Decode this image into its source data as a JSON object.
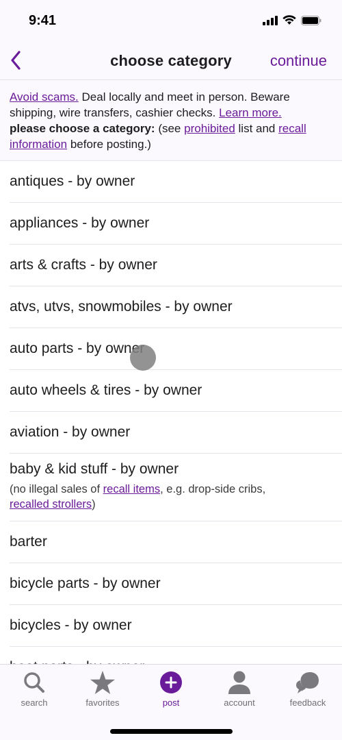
{
  "status_bar": {
    "time": "9:41"
  },
  "nav": {
    "title": "choose category",
    "continue_label": "continue"
  },
  "notice": {
    "avoid_scams": "Avoid scams.",
    "text1": " Deal locally and meet in person. Beware shipping, wire transfers, cashier checks. ",
    "learn_more": "Learn more.",
    "bold": "please choose a category:",
    "text2": " (see ",
    "prohibited": "prohibited",
    "text3": " list and ",
    "recall_info": "recall information",
    "text4": " before posting.)"
  },
  "categories": [
    {
      "label": "antiques - by owner"
    },
    {
      "label": "appliances - by owner"
    },
    {
      "label": "arts & crafts - by owner"
    },
    {
      "label": "atvs, utvs, snowmobiles - by owner"
    },
    {
      "label": "auto parts - by owner"
    },
    {
      "label": "auto wheels & tires - by owner"
    },
    {
      "label": "aviation - by owner"
    },
    {
      "label": "baby & kid stuff - by owner",
      "note": {
        "text1": "(no illegal sales of ",
        "link1": "recall items",
        "text2": ", e.g. drop-side cribs, ",
        "link2": "recalled strollers",
        "text3": ")"
      }
    },
    {
      "label": "barter"
    },
    {
      "label": "bicycle parts - by owner"
    },
    {
      "label": "bicycles - by owner"
    },
    {
      "label": "boat parts - by owner"
    }
  ],
  "tabs": [
    {
      "label": "search",
      "icon": "search-icon"
    },
    {
      "label": "favorites",
      "icon": "star-icon"
    },
    {
      "label": "post",
      "icon": "plus-circle-icon",
      "active": true
    },
    {
      "label": "account",
      "icon": "person-icon"
    },
    {
      "label": "feedback",
      "icon": "chat-bubbles-icon"
    }
  ],
  "colors": {
    "accent": "#6a1b9a",
    "icon_gray": "#7a7a7e"
  }
}
